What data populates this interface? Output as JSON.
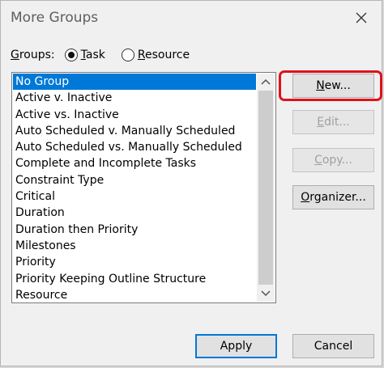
{
  "dialog": {
    "title": "More Groups",
    "groups_label": "Groups:",
    "radio_task": {
      "label": "Task",
      "selected": true
    },
    "radio_resource": {
      "label": "Resource",
      "selected": false
    }
  },
  "list": {
    "items": [
      "No Group",
      "Active v. Inactive",
      "Active vs. Inactive",
      "Auto Scheduled v. Manually Scheduled",
      "Auto Scheduled vs. Manually Scheduled",
      "Complete and Incomplete Tasks",
      "Constraint Type",
      "Critical",
      "Duration",
      "Duration then Priority",
      "Milestones",
      "Priority",
      "Priority Keeping Outline Structure",
      "Resource"
    ],
    "selected_index": 0
  },
  "buttons": {
    "new": "New...",
    "edit": "Edit...",
    "copy": "Copy...",
    "organizer": "Organizer...",
    "apply": "Apply",
    "cancel": "Cancel"
  },
  "colors": {
    "selection": "#0078d7",
    "highlight": "#e0101a"
  }
}
